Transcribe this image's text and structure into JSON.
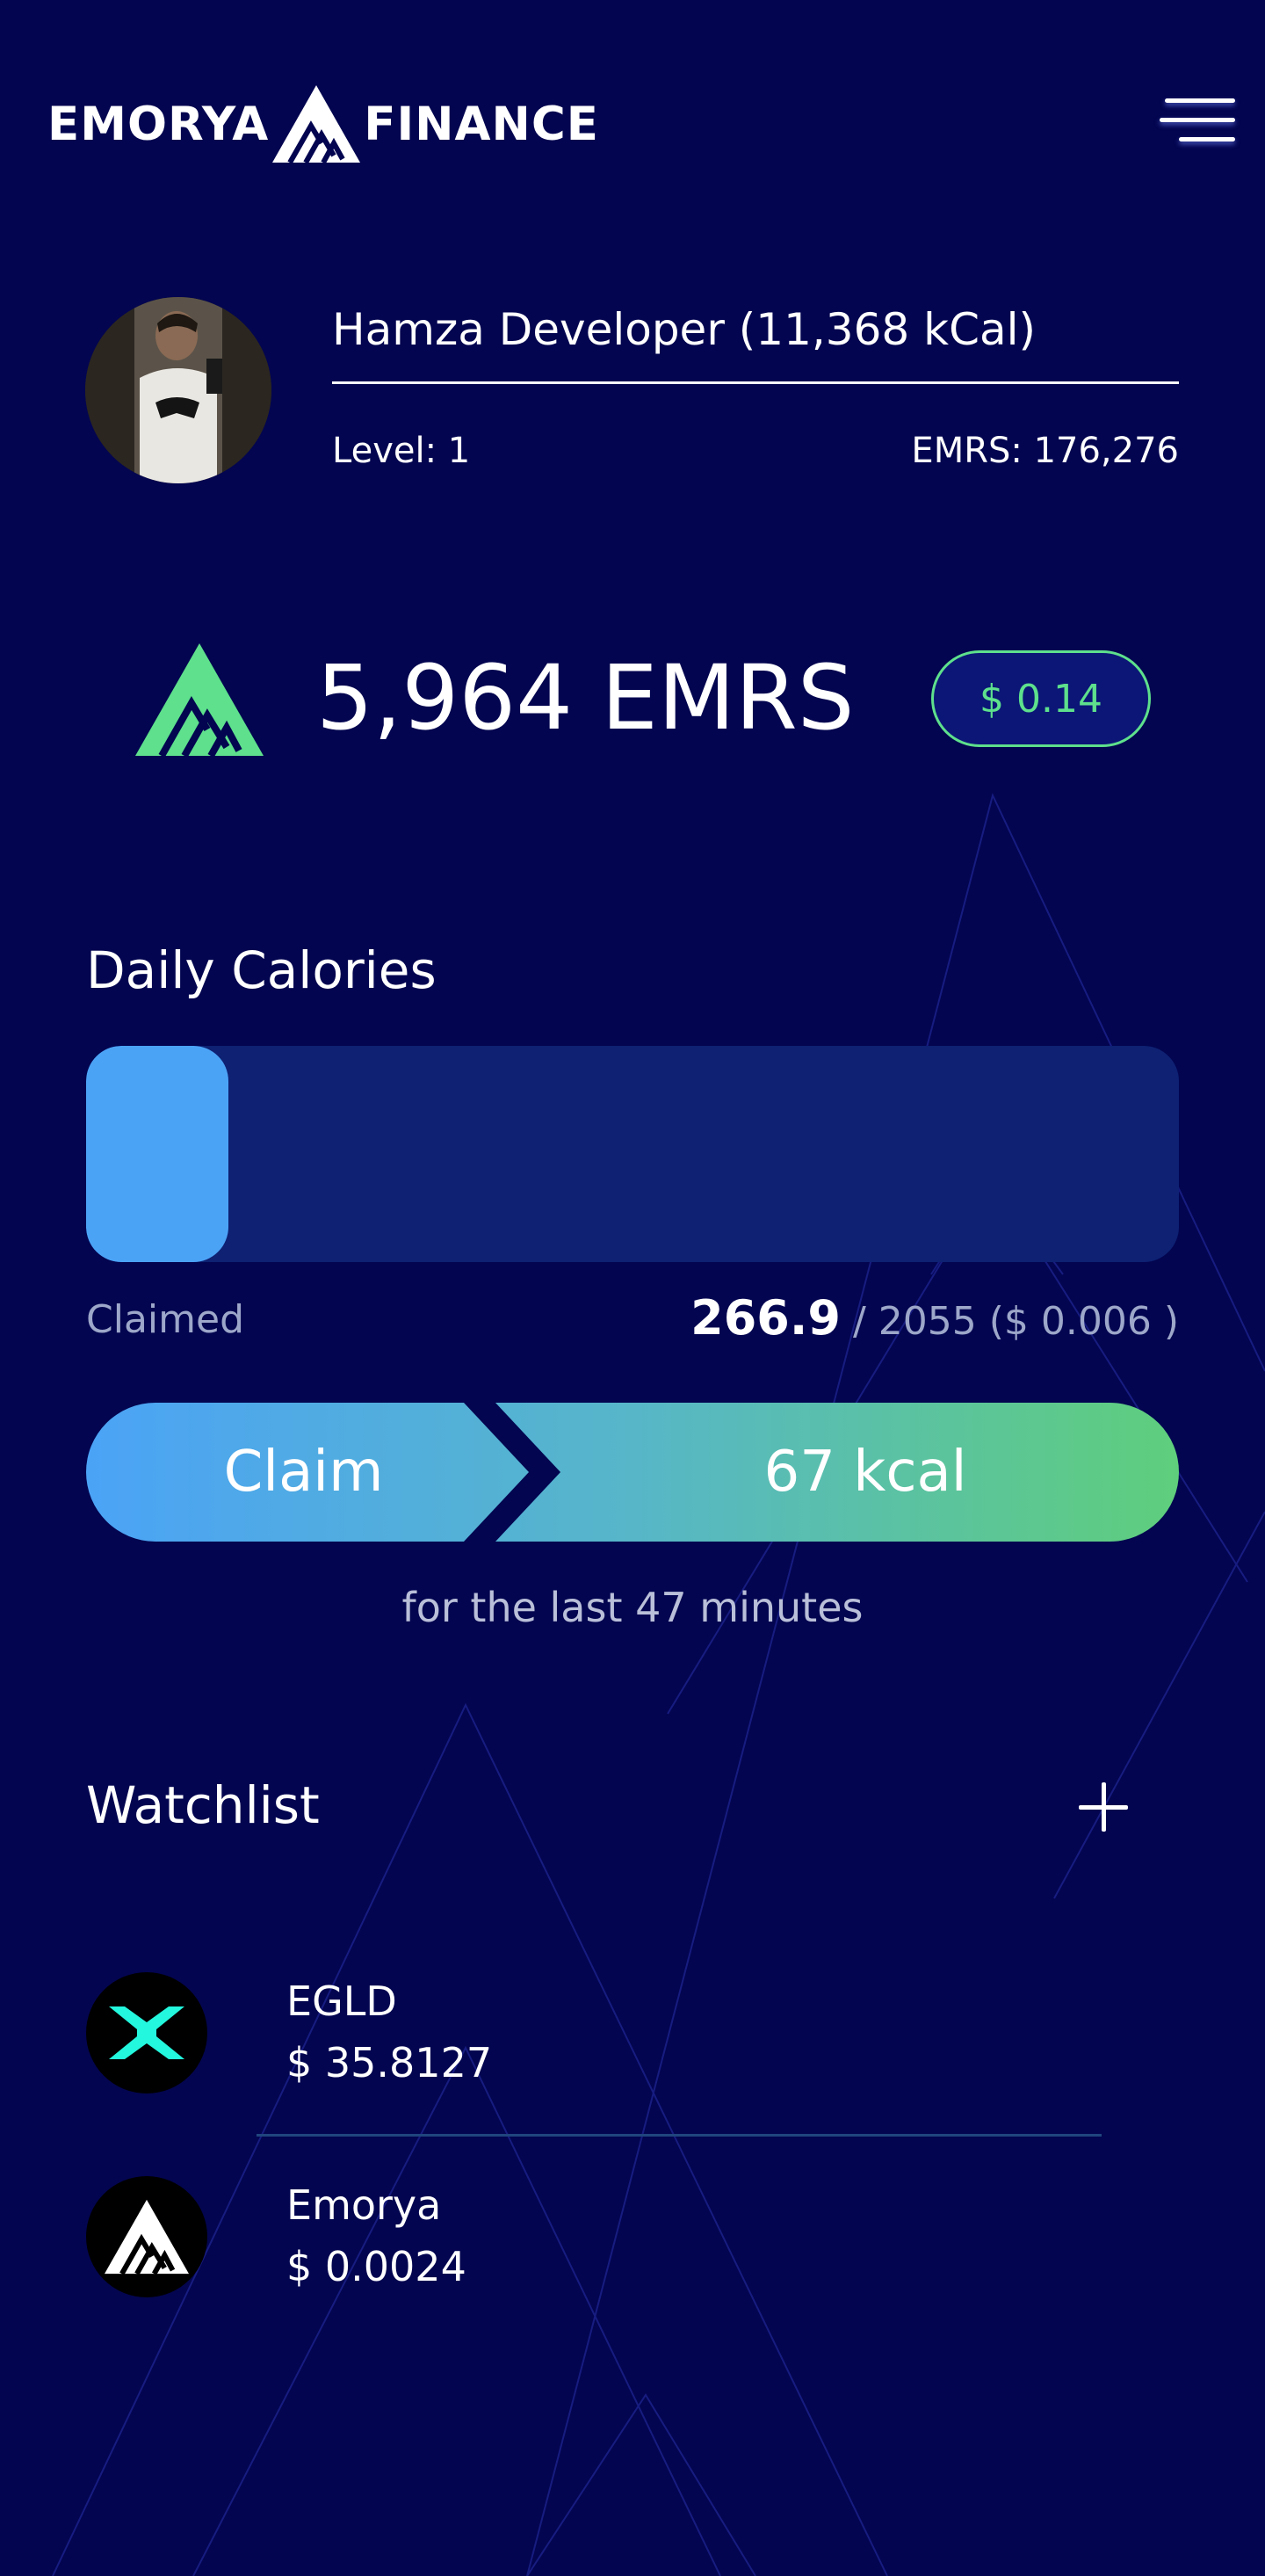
{
  "header": {
    "brand_left": "EMORYA",
    "brand_right": "FINANCE",
    "logo_icon": "emorya-logo-icon",
    "menu_icon": "hamburger-menu-icon"
  },
  "profile": {
    "name": "Hamza Developer (11,368 kCal)",
    "level": "Level: 1",
    "emrs": "EMRS: 176,276"
  },
  "balance": {
    "amount": "5,964 EMRS",
    "usd": "$ 0.14",
    "accent": "#5ee08c"
  },
  "daily_calories": {
    "title": "Daily Calories",
    "claimed_label": "Claimed",
    "current": "266.9",
    "rest": "/ 2055 ($ 0.006 )",
    "progress_fraction": 0.13,
    "bar_color": "#4ba3f6"
  },
  "claim": {
    "label": "Claim",
    "amount": "67 kcal",
    "note": "for the last 47 minutes"
  },
  "watchlist": {
    "title": "Watchlist",
    "add_icon": "plus-icon",
    "items": [
      {
        "name": "EGLD",
        "price": "$ 35.8127",
        "icon": "egld-icon"
      },
      {
        "name": "Emorya",
        "price": "$ 0.0024",
        "icon": "emorya-coin-icon"
      }
    ]
  },
  "colors": {
    "background": "#030550",
    "claim_gradient_start": "#4ba3f6",
    "claim_gradient_end": "#5fce7c"
  }
}
